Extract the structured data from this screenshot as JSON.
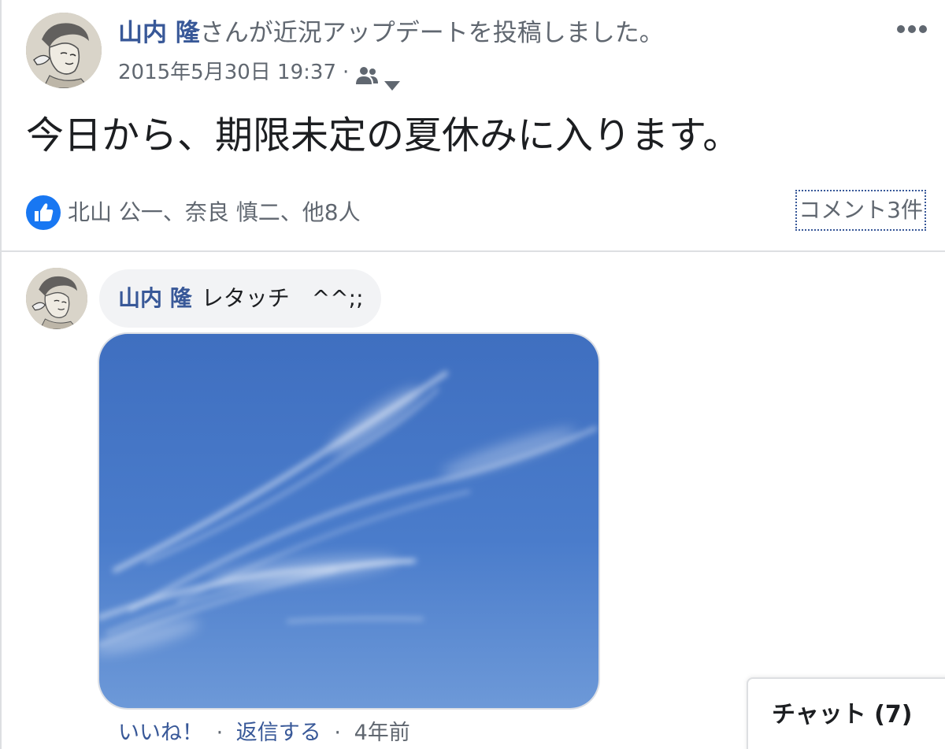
{
  "post": {
    "author": "山内 隆",
    "action": "さんが近況アップデートを投稿しました。",
    "timestamp": "2015年5月30日 19:37",
    "separator": "·",
    "audience_icon": "friends-icon",
    "text": "今日から、期限未定の夏休みに入ります。",
    "more_icon": "more-dots-icon"
  },
  "reactions": {
    "icon": "like-icon",
    "names": "北山 公一、奈良 慎二、他8人",
    "comment_count": "コメント3件"
  },
  "comment": {
    "author": "山内 隆",
    "text": "レタッチ　^^;;",
    "photo_description": "sky-photo",
    "actions": {
      "like": "いいね！",
      "reply": "返信する",
      "separator": "·",
      "age": "4年前"
    }
  },
  "chat": {
    "label": "チャット (7)"
  },
  "colors": {
    "link": "#385898",
    "secondary_text": "#606770",
    "primary_text": "#1c1e21",
    "like_blue": "#1877f2",
    "bubble_bg": "#f2f3f5",
    "divider": "#dddfe2"
  }
}
